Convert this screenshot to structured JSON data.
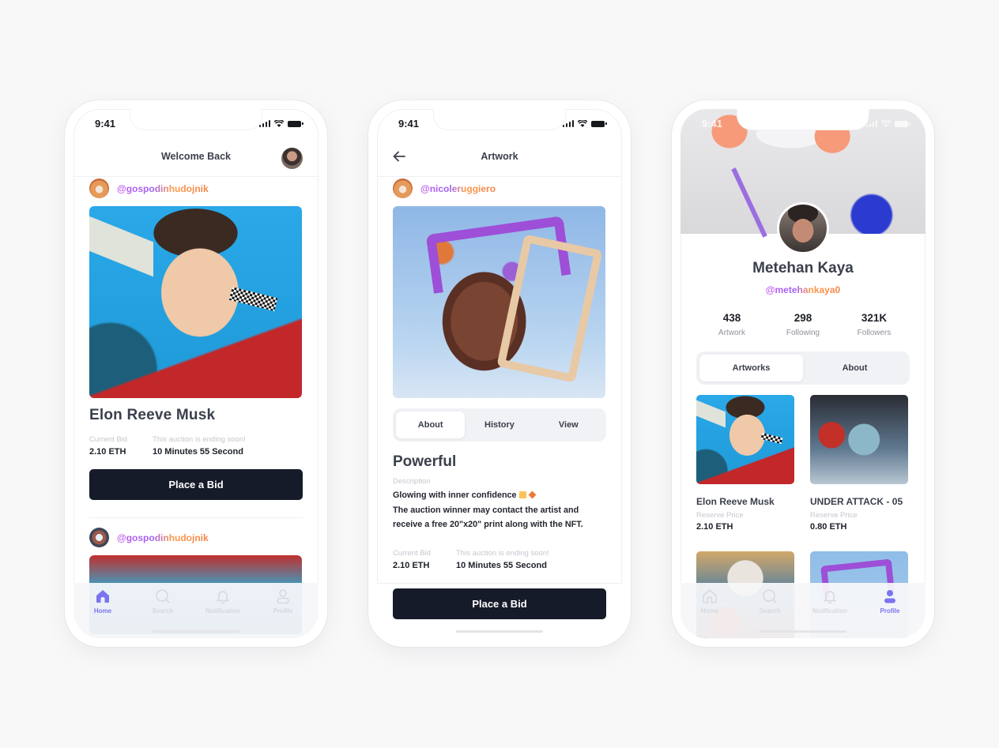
{
  "status_time": "9:41",
  "colors": {
    "accent": "#7b74f0",
    "button_dark": "#161b29",
    "handle_gradient_start": "#c35cf0",
    "handle_gradient_end": "#f2824a",
    "background": "#f8f8f9"
  },
  "home_screen": {
    "title": "Welcome Back",
    "posts": [
      {
        "author": "@gospodinhudojnik",
        "artwork_title": "Elon Reeve Musk",
        "current_bid_label": "Current Bid",
        "current_bid": "2.10 ETH",
        "ending_label": "This auction is ending soon!",
        "time_left": "10 Minutes 55 Second",
        "button_label": "Place a Bid"
      },
      {
        "author": "@gospodinhudojnik"
      }
    ]
  },
  "artwork_screen": {
    "title": "Artwork",
    "back_icon": "arrow-left-icon",
    "author": "@nicoleruggiero",
    "tabs": [
      "About",
      "History",
      "View"
    ],
    "active_tab": "About",
    "artwork_title": "Powerful",
    "description_label": "Description",
    "description_line1": "Glowing with inner confidence",
    "description_line2": "The auction winner may contact the artist and receive a free 20\"x20\" print along with the NFT.",
    "current_bid_label": "Current Bid",
    "current_bid": "2.10 ETH",
    "ending_label": "This auction is ending soon!",
    "time_left": "10 Minutes 55 Second",
    "button_label": "Place a Bid"
  },
  "profile_screen": {
    "name": "Metehan Kaya",
    "handle": "@metehankaya0",
    "stats": [
      {
        "value": "438",
        "label": "Artwork"
      },
      {
        "value": "298",
        "label": "Following"
      },
      {
        "value": "321K",
        "label": "Followers"
      }
    ],
    "tabs": [
      "Artworks",
      "About"
    ],
    "active_tab": "Artworks",
    "artworks": [
      {
        "title": "Elon Reeve Musk",
        "price_label": "Reserve Price",
        "price": "2.10 ETH"
      },
      {
        "title": "UNDER ATTACK - 05",
        "price_label": "Reserve Price",
        "price": "0.80 ETH"
      }
    ]
  },
  "tabbar": {
    "items": [
      {
        "label": "Home",
        "icon": "home-icon"
      },
      {
        "label": "Search",
        "icon": "search-icon"
      },
      {
        "label": "Notification",
        "icon": "bell-icon"
      },
      {
        "label": "Profile",
        "icon": "user-icon"
      }
    ]
  }
}
